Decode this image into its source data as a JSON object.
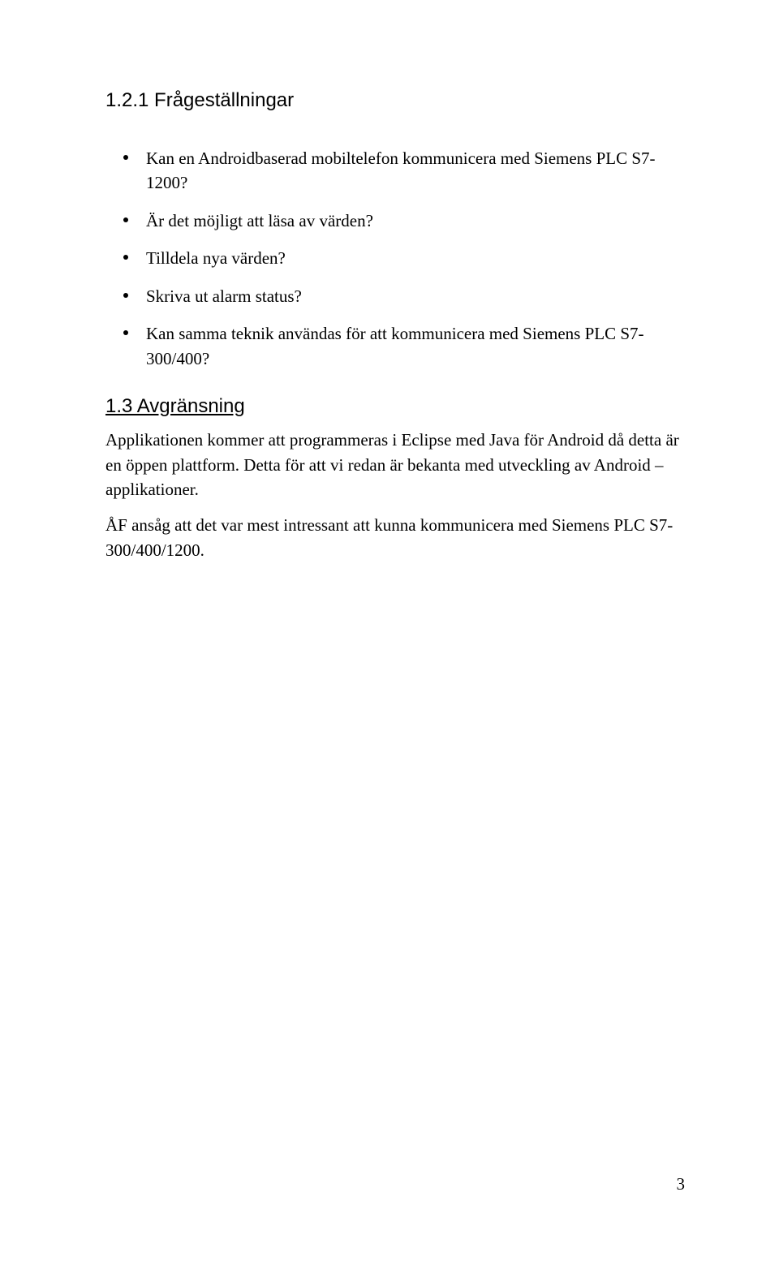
{
  "section1": {
    "heading": "1.2.1 Frågeställningar",
    "bullets": [
      "Kan en Androidbaserad mobiltelefon kommunicera med Siemens PLC S7-1200?",
      "Är det möjligt att läsa av värden?",
      "Tilldela nya värden?",
      "Skriva ut alarm status?",
      "Kan samma teknik användas för att kommunicera med Siemens PLC S7-300/400?"
    ]
  },
  "section2": {
    "heading": "1.3 Avgränsning",
    "paragraph": "Applikationen kommer att programmeras i Eclipse med Java för Android då detta är en öppen plattform. Detta för att vi redan är bekanta med utveckling av Android – applikationer.",
    "paragraph2": "ÅF ansåg att det var mest intressant att kunna kommunicera med Siemens PLC S7-300/400/1200."
  },
  "pageNumber": "3"
}
